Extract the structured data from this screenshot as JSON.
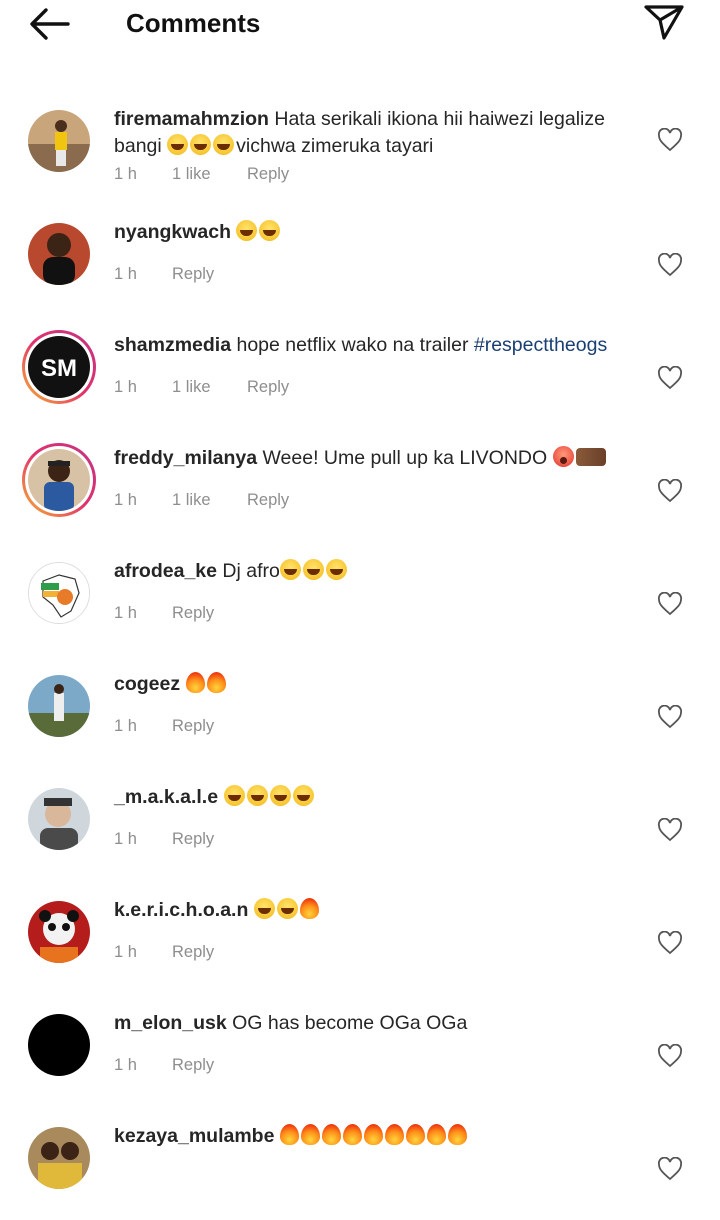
{
  "header": {
    "title": "Comments",
    "back_icon": "arrow-left-icon",
    "send_icon": "paper-plane-icon"
  },
  "comments": [
    {
      "username": "firemamahmzion",
      "text_before": " Hata serikali ikiona hii haiwezi legalize bangi ",
      "emoji": [
        "laugh",
        "laugh",
        "laugh"
      ],
      "text_after": "vichwa zimeruka tayari",
      "time": "1 h",
      "likes": "1 like",
      "reply": "Reply"
    },
    {
      "username": "nyangkwach",
      "text_before": " ",
      "emoji": [
        "laugh",
        "laugh"
      ],
      "text_after": "",
      "time": "1 h",
      "likes": "",
      "reply": "Reply"
    },
    {
      "username": "shamzmedia",
      "text_before": " hope netflix wako na trailer ",
      "hashtag": "#respecttheogs",
      "emoji": [],
      "text_after": "",
      "time": "1 h",
      "likes": "1 like",
      "reply": "Reply"
    },
    {
      "username": "freddy_milanya",
      "text_before": " Weee! Ume pull up ka LIVONDO ",
      "emoji": [
        "shock",
        "hands"
      ],
      "text_after": "",
      "time": "1 h",
      "likes": "1 like",
      "reply": "Reply"
    },
    {
      "username": "afrodea_ke",
      "text_before": " Dj afro",
      "emoji": [
        "laugh",
        "laugh",
        "laugh"
      ],
      "text_after": "",
      "time": "1 h",
      "likes": "",
      "reply": "Reply"
    },
    {
      "username": "cogeez",
      "text_before": " ",
      "emoji": [
        "fire",
        "fire"
      ],
      "text_after": "",
      "time": "1 h",
      "likes": "",
      "reply": "Reply"
    },
    {
      "username": "_m.a.k.a.l.e",
      "text_before": " ",
      "emoji": [
        "laugh",
        "laugh",
        "laugh",
        "laugh"
      ],
      "text_after": "",
      "time": "1 h",
      "likes": "",
      "reply": "Reply"
    },
    {
      "username": "k.e.r.i.c.h.o.a.n",
      "text_before": " ",
      "emoji": [
        "laugh",
        "laugh",
        "fire"
      ],
      "text_after": "",
      "time": "1 h",
      "likes": "",
      "reply": "Reply"
    },
    {
      "username": "m_elon_usk",
      "text_before": " OG has become OGa OGa",
      "emoji": [],
      "text_after": "",
      "time": "1 h",
      "likes": "",
      "reply": "Reply"
    },
    {
      "username": "kezaya_mulambe",
      "text_before": " ",
      "emoji": [
        "fire",
        "fire",
        "fire",
        "fire",
        "fire",
        "fire",
        "fire",
        "fire",
        "fire"
      ],
      "text_after": "",
      "time": "",
      "likes": "",
      "reply": ""
    }
  ],
  "colors": {
    "meta_gray": "#8e8e8e",
    "hashtag_blue": "#1a3f73",
    "text": "#262626"
  }
}
